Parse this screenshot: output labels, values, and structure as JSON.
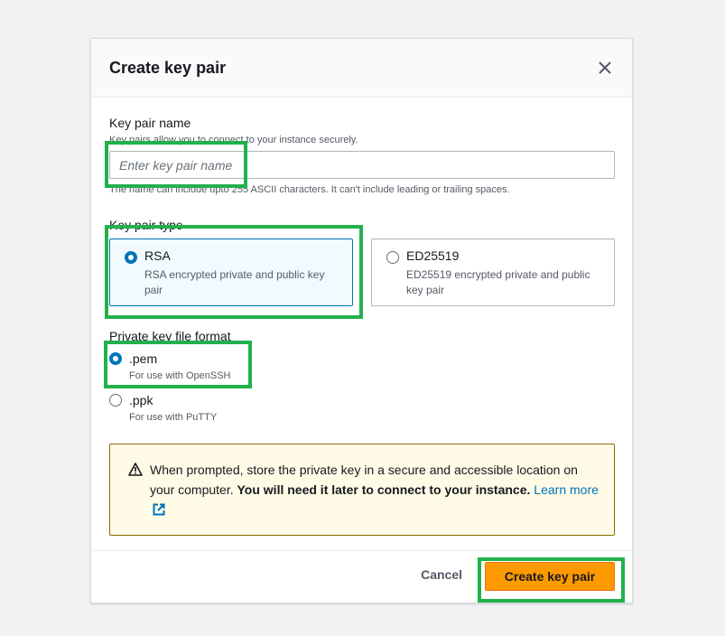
{
  "modal": {
    "title": "Create key pair",
    "close_icon": "close-icon"
  },
  "key_name": {
    "label": "Key pair name",
    "description": "Key pairs allow you to connect to your instance securely.",
    "placeholder": "Enter key pair name",
    "value": "",
    "constraint": "The name can include upto 255 ASCII characters. It can't include leading or trailing spaces."
  },
  "key_type": {
    "label": "Key pair type",
    "options": [
      {
        "title": "RSA",
        "description": "RSA encrypted private and public key pair",
        "selected": true
      },
      {
        "title": "ED25519",
        "description": "ED25519 encrypted private and public key pair",
        "selected": false
      }
    ]
  },
  "file_format": {
    "label": "Private key file format",
    "options": [
      {
        "title": ".pem",
        "description": "For use with OpenSSH",
        "selected": true
      },
      {
        "title": ".ppk",
        "description": "For use with PuTTY",
        "selected": false
      }
    ]
  },
  "alert": {
    "icon": "warning-icon",
    "text_plain": "When prompted, store the private key in a secure and accessible location on your computer. ",
    "text_bold": "You will need it later to connect to your instance.",
    "link_text": "Learn more",
    "link_icon": "external-link-icon"
  },
  "footer": {
    "cancel_label": "Cancel",
    "submit_label": "Create key pair"
  },
  "colors": {
    "primary": "#ff9900",
    "selection": "#0073bb",
    "highlight": "#22b14c",
    "warning_bg": "#fffbe6"
  }
}
